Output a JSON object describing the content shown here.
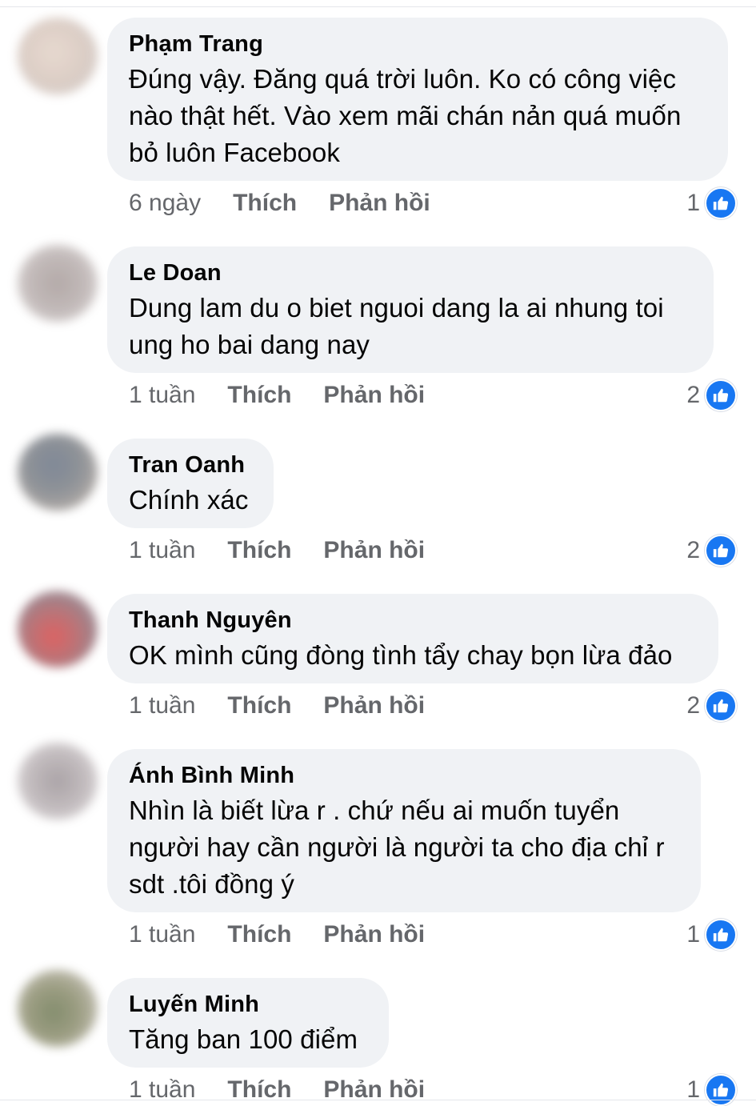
{
  "comments": [
    {
      "author": "Phạm Trang",
      "text": "Đúng vậy. Đăng quá trời luôn. Ko có công việc nào thật hết. Vào xem mãi chán nản quá muốn bỏ luôn Facebook",
      "time": "6 ngày",
      "like": "Thích",
      "reply": "Phản hồi",
      "reactions": "1"
    },
    {
      "author": "Le Doan",
      "text": "Dung lam du o biet nguoi dang la ai nhung toi ung ho bai dang nay",
      "time": "1 tuần",
      "like": "Thích",
      "reply": "Phản hồi",
      "reactions": "2"
    },
    {
      "author": "Tran Oanh",
      "text": "Chính xác",
      "time": "1 tuần",
      "like": "Thích",
      "reply": "Phản hồi",
      "reactions": "2"
    },
    {
      "author": "Thanh Nguyên",
      "text": "OK mình cũng đòng tình tẩy chay bọn lừa đảo",
      "time": "1 tuần",
      "like": "Thích",
      "reply": "Phản hồi",
      "reactions": "2"
    },
    {
      "author": "Ánh Bình Minh",
      "text": "Nhìn là biết lừa r . chứ nếu ai muốn tuyển người hay cần người là người ta cho địa chỉ r sdt .tôi đồng ý",
      "time": "1 tuần",
      "like": "Thích",
      "reply": "Phản hồi",
      "reactions": "1"
    },
    {
      "author": "Luyến Minh",
      "text": "Tăng ban 100 điểm",
      "time": "1 tuần",
      "like": "Thích",
      "reply": "Phản hồi",
      "reactions": "1"
    }
  ],
  "icons": {
    "reaction": "thumbs-up-icon"
  },
  "colors": {
    "bubble_bg": "#f0f2f5",
    "like_blue": "#1877f2",
    "meta_gray": "#65676b"
  }
}
